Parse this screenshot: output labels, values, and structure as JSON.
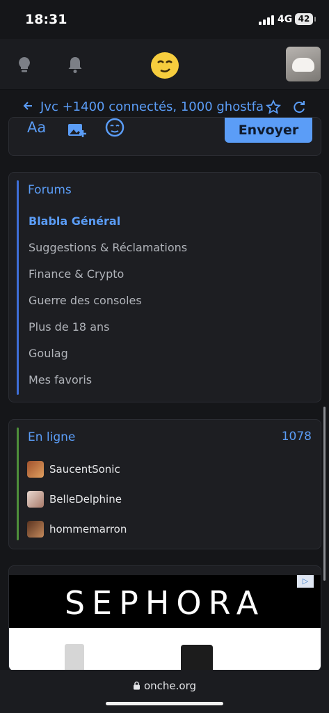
{
  "status_bar": {
    "time": "18:31",
    "network": "4G",
    "battery": "42"
  },
  "topbar": {
    "icons": [
      "lightbulb-icon",
      "bell-icon",
      "smiley-logo-icon",
      "user-avatar"
    ]
  },
  "thread": {
    "title": "Jvc +1400 connectés, 1000 ghostfa"
  },
  "editor": {
    "format_label": "Aa",
    "send_label": "Envoyer"
  },
  "forums": {
    "title": "Forums",
    "items": [
      "Blabla Général",
      "Suggestions & Réclamations",
      "Finance & Crypto",
      "Guerre des consoles",
      "Plus de 18 ans",
      "Goulag",
      "Mes favoris"
    ]
  },
  "online": {
    "title": "En ligne",
    "count": "1078",
    "users": [
      "SaucentSonic",
      "BelleDelphine",
      "hommemarron"
    ]
  },
  "ad": {
    "brand": "SEPHORA",
    "choices": "▷"
  },
  "browser": {
    "url": "onche.org"
  },
  "colors": {
    "accent": "#5b9df7",
    "forum_bar": "#3f6fd8",
    "online_bar": "#4e8f3b",
    "background": "#151619"
  }
}
